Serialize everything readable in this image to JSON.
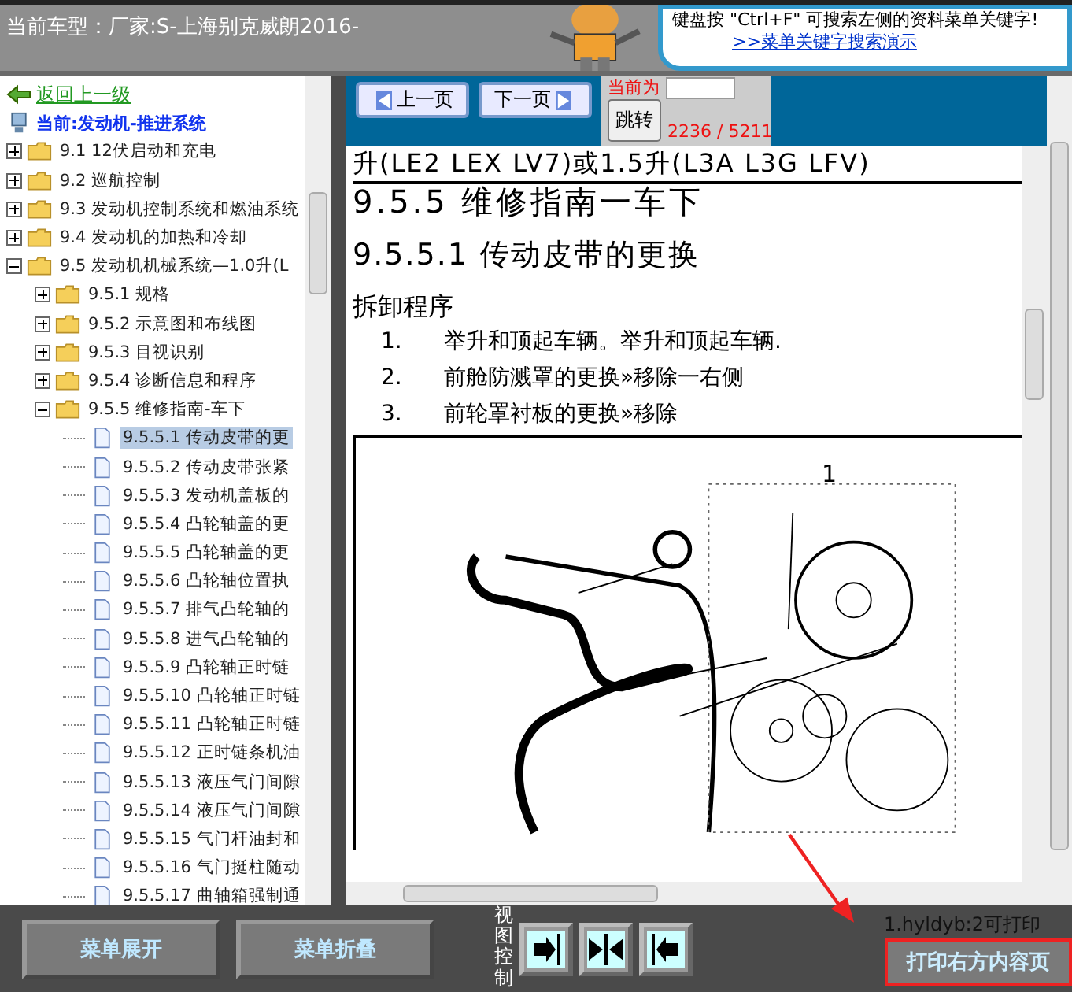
{
  "header": {
    "car_model": "当前车型：厂家:S-上海别克威朗2016-",
    "tip": "键盘按 \"Ctrl+F\" 可搜索左侧的资料菜单关键字!",
    "tip_link": ">>菜单关键字搜索演示"
  },
  "sidebar": {
    "back_link": "返回上一级",
    "current": "当前:发动机-推进系统",
    "tree": [
      {
        "label": "9.1 12伏启动和充电",
        "kind": "folder",
        "expanded": false,
        "selected": false
      },
      {
        "label": "9.2 巡航控制",
        "kind": "folder",
        "expanded": false,
        "selected": false
      },
      {
        "label": "9.3 发动机控制系统和燃油系统",
        "kind": "folder",
        "expanded": false,
        "selected": false
      },
      {
        "label": "9.4 发动机的加热和冷却",
        "kind": "folder",
        "expanded": false,
        "selected": false
      },
      {
        "label": "9.5 发动机机械系统—1.0升(L",
        "kind": "folder",
        "expanded": true,
        "selected": false,
        "children": [
          {
            "label": "9.5.1 规格",
            "kind": "folder",
            "expanded": false,
            "selected": false
          },
          {
            "label": "9.5.2 示意图和布线图",
            "kind": "folder",
            "expanded": false,
            "selected": false
          },
          {
            "label": "9.5.3 目视识别",
            "kind": "folder",
            "expanded": false,
            "selected": false
          },
          {
            "label": "9.5.4 诊断信息和程序",
            "kind": "folder",
            "expanded": false,
            "selected": false
          },
          {
            "label": "9.5.5 维修指南-车下",
            "kind": "folder",
            "expanded": true,
            "selected": false,
            "children": [
              {
                "label": "9.5.5.1 传动皮带的更",
                "kind": "doc",
                "selected": true
              },
              {
                "label": "9.5.5.2 传动皮带张紧",
                "kind": "doc",
                "selected": false
              },
              {
                "label": "9.5.5.3 发动机盖板的",
                "kind": "doc",
                "selected": false
              },
              {
                "label": "9.5.5.4 凸轮轴盖的更",
                "kind": "doc",
                "selected": false
              },
              {
                "label": "9.5.5.5 凸轮轴盖的更",
                "kind": "doc",
                "selected": false
              },
              {
                "label": "9.5.5.6 凸轮轴位置执",
                "kind": "doc",
                "selected": false
              },
              {
                "label": "9.5.5.7 排气凸轮轴的",
                "kind": "doc",
                "selected": false
              },
              {
                "label": "9.5.5.8 进气凸轮轴的",
                "kind": "doc",
                "selected": false
              },
              {
                "label": "9.5.5.9 凸轮轴正时链",
                "kind": "doc",
                "selected": false
              },
              {
                "label": "9.5.5.10 凸轮轴正时链",
                "kind": "doc",
                "selected": false
              },
              {
                "label": "9.5.5.11 凸轮轴正时链",
                "kind": "doc",
                "selected": false
              },
              {
                "label": "9.5.5.12 正时链条机油",
                "kind": "doc",
                "selected": false
              },
              {
                "label": "9.5.5.13 液压气门间隙",
                "kind": "doc",
                "selected": false
              },
              {
                "label": "9.5.5.14 液压气门间隙",
                "kind": "doc",
                "selected": false
              },
              {
                "label": "9.5.5.15 气门杆油封和",
                "kind": "doc",
                "selected": false
              },
              {
                "label": "9.5.5.16 气门挺柱随动",
                "kind": "doc",
                "selected": false
              },
              {
                "label": "9.5.5.17 曲轴箱强制通",
                "kind": "doc",
                "selected": false
              }
            ]
          }
        ]
      }
    ]
  },
  "toolbar": {
    "prev": "上一页",
    "next": "下一页",
    "page_label": "当前为",
    "jump": "跳转",
    "page_count": "2236 / 5211"
  },
  "document": {
    "subtitle": "升(LE2 LEX LV7)或1.5升(L3A L3G LFV)",
    "section": "9.5.5 维修指南一车下",
    "title": "9.5.5.1 传动皮带的更换",
    "procedure": "拆卸程序",
    "steps": [
      {
        "number": "1.",
        "text": "举升和顶起车辆。举升和顶起车辆."
      },
      {
        "number": "2.",
        "text": "前舱防溅罩的更换»移除一右侧"
      },
      {
        "number": "3.",
        "text": "前轮罩衬板的更换»移除"
      }
    ],
    "figure_callout": "1"
  },
  "bottom": {
    "expand": "菜单展开",
    "collapse": "菜单折叠",
    "view_label": "视图控制",
    "print_mode": "1.hyldyb:2可打印",
    "print": "打印右方内容页"
  }
}
